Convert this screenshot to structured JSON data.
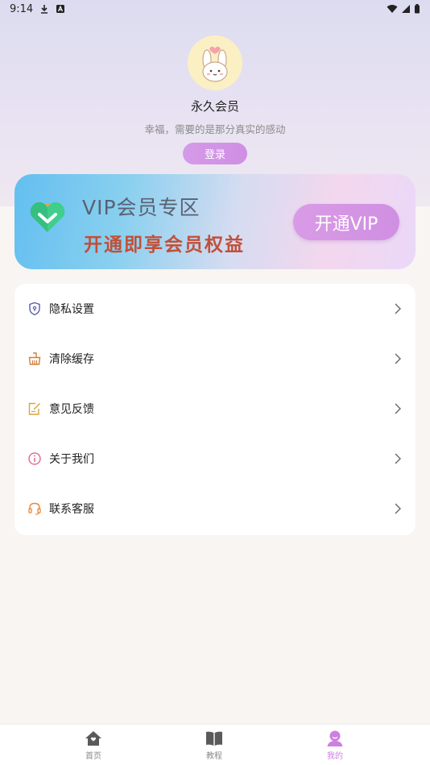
{
  "status_bar": {
    "time": "9:14"
  },
  "profile": {
    "name": "永久会员",
    "motto": "幸福，需要的是那分真实的感动",
    "login_label": "登录"
  },
  "vip": {
    "title": "VIP会员专区",
    "subtitle": "开通即享会员权益",
    "button_label": "开通VIP"
  },
  "menu": {
    "items": [
      {
        "label": "隐私设置",
        "icon": "shield-icon"
      },
      {
        "label": "清除缓存",
        "icon": "broom-icon"
      },
      {
        "label": "意见反馈",
        "icon": "feedback-icon"
      },
      {
        "label": "关于我们",
        "icon": "info-icon"
      },
      {
        "label": "联系客服",
        "icon": "headset-icon"
      }
    ]
  },
  "tabbar": {
    "tabs": [
      {
        "label": "首页",
        "icon": "home-icon",
        "active": false
      },
      {
        "label": "教程",
        "icon": "book-icon",
        "active": false
      },
      {
        "label": "我的",
        "icon": "profile-icon",
        "active": true
      }
    ]
  },
  "colors": {
    "accent": "#cd7fe2",
    "vip_subtitle": "#c24f38",
    "page_bg": "#f8f5f2"
  }
}
